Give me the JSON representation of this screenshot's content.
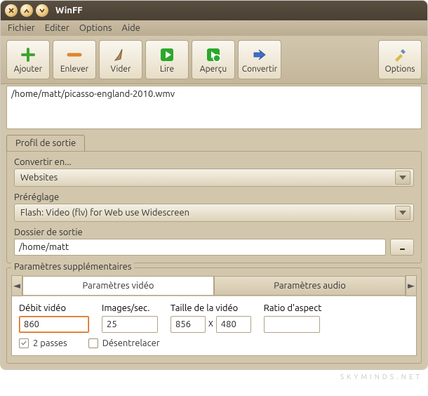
{
  "window": {
    "title": "WinFF"
  },
  "menu": {
    "file": "Fichier",
    "edit": "Editer",
    "options": "Options",
    "help": "Aide"
  },
  "toolbar": {
    "add": "Ajouter",
    "remove": "Enlever",
    "clear": "Vider",
    "play": "Lire",
    "preview": "Aperçu",
    "convert": "Convertir",
    "options": "Options"
  },
  "file_list": {
    "item0": "/home/matt/picasso-england-2010.wmv"
  },
  "profile": {
    "tab": "Profil de sortie",
    "convert_to_label": "Convertir en...",
    "convert_to_value": "Websites",
    "preset_label": "Préréglage",
    "preset_value": "Flash: Video (flv) for Web use Widescreen",
    "output_folder_label": "Dossier de sortie",
    "output_folder_value": "/home/matt",
    "browse_label": "..."
  },
  "extra_params": {
    "legend": "Paramètres supplémentaires",
    "tab_video": "Paramètres vidéo",
    "tab_audio": "Paramètres audio",
    "bitrate_label": "Débit vidéo",
    "bitrate_value": "860",
    "fps_label": "Images/sec.",
    "fps_value": "25",
    "size_label": "Taille de la vidéo",
    "size_w": "856",
    "size_sep": "X",
    "size_h": "480",
    "aspect_label": "Ratio d'aspect",
    "aspect_value": "",
    "two_pass": "2 passes",
    "deinterlace": "Désentrelacer"
  },
  "watermark": "SKYMINDS.NET"
}
